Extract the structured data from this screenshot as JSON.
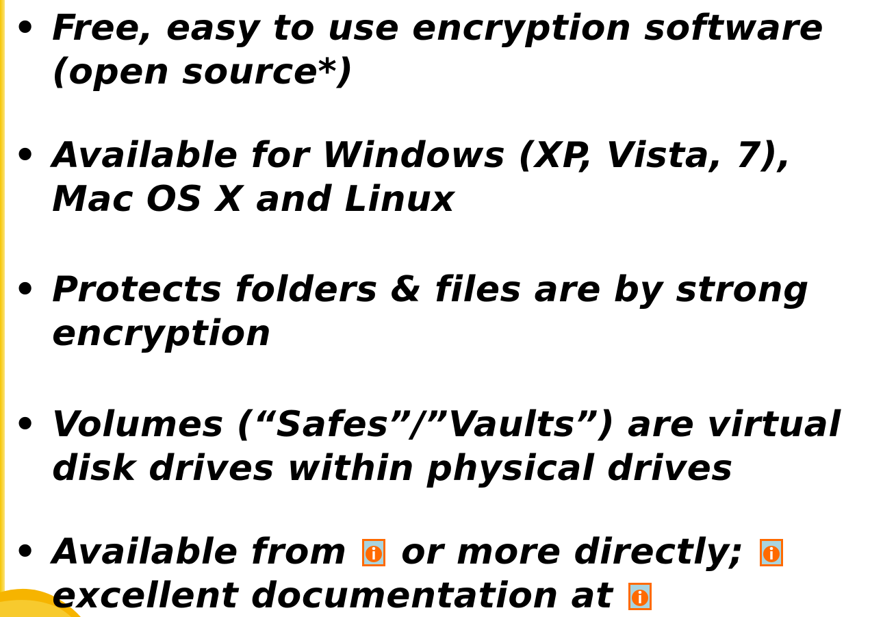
{
  "bullets": [
    {
      "line1": "Free, easy to use encryption software",
      "line2": "(open source*)"
    },
    {
      "line1": "Available for Windows (XP, Vista, 7),",
      "line2": "Mac OS X and Linux"
    },
    {
      "line1": "Protects folders & files are by strong",
      "line2": "encryption"
    },
    {
      "line1": "Volumes (“Safes”/”Vaults”) are virtual",
      "line2": "disk drives within physical drives"
    },
    {
      "line1a": "Available from",
      "line1b": "or more directly;",
      "line2": "excellent documentation at"
    }
  ],
  "bullet_char": "•",
  "icons": {
    "info_link": "info-link-icon"
  },
  "colors": {
    "text": "#000000",
    "accent_yellow": "#f6c500",
    "icon_orange": "#ff6a00",
    "icon_bg": "#a9d4e0"
  }
}
